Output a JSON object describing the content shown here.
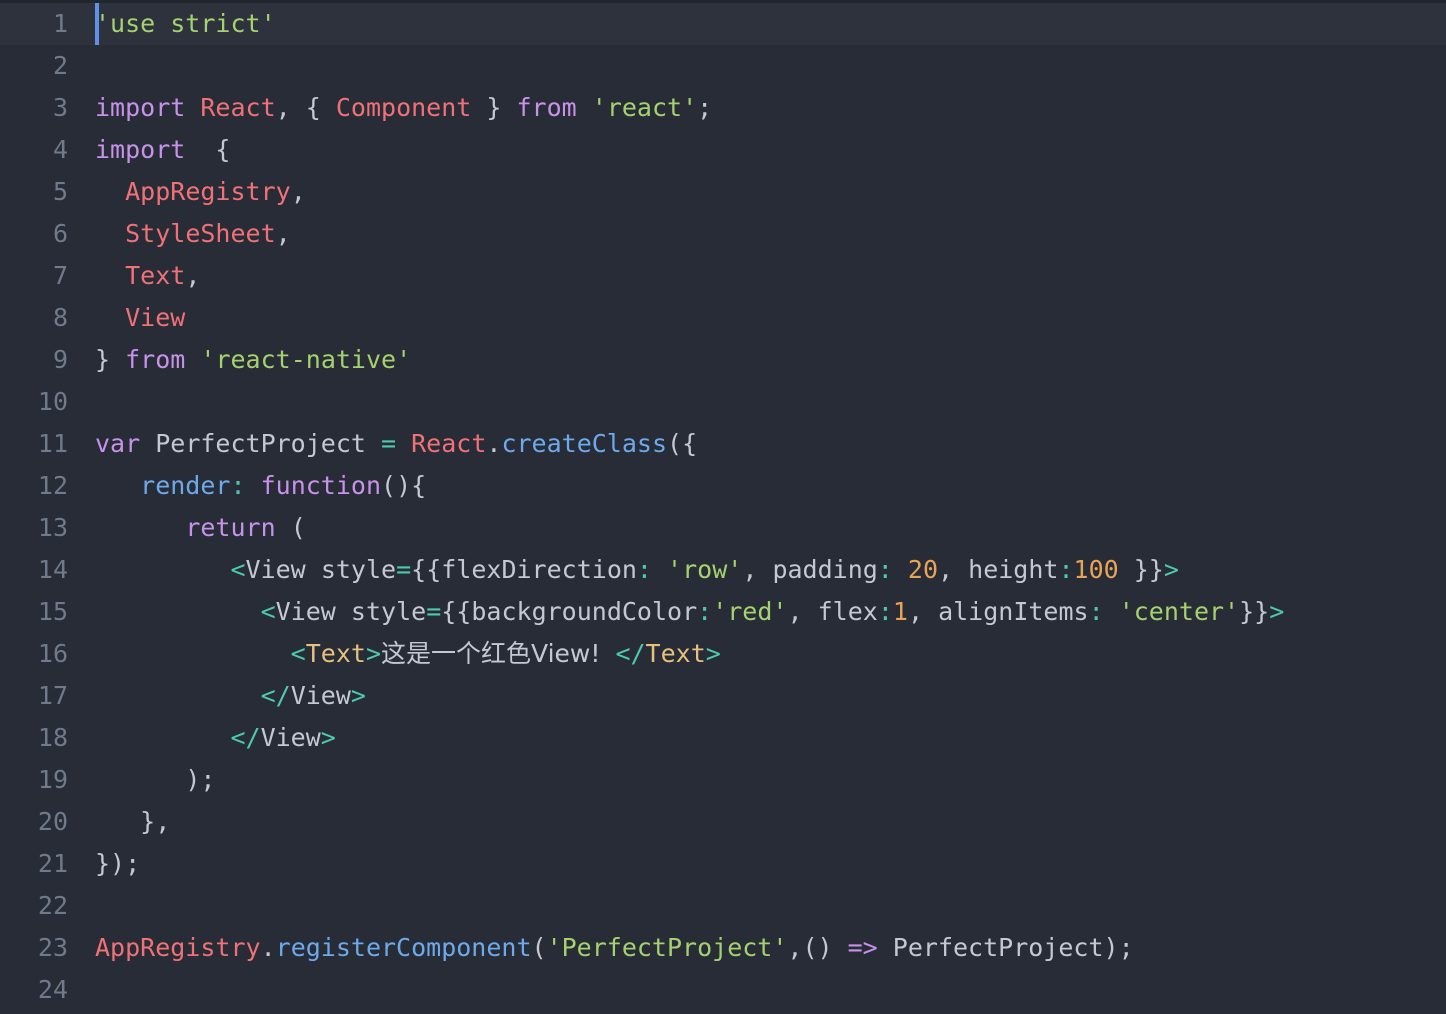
{
  "editor": {
    "name": "code-editor",
    "language": "javascript-jsx",
    "theme": {
      "background": "#272c36",
      "active_line_background": "#2d323d",
      "gutter_text": "#717a8a",
      "caret": "#5c93e8",
      "plain": "#c3c8d2",
      "keyword": "#c792ea",
      "class_name": "#f07178",
      "string": "#a5d26e",
      "function": "#6eaaeb",
      "operator": "#4ec9b0",
      "number": "#e8a355",
      "tag_name": "#e8c07d"
    },
    "caret_line": 1,
    "caret_column": 1,
    "total_lines": 24
  },
  "lines": [
    {
      "num": "1",
      "active": true,
      "tokens": [
        {
          "t": "'use strict'",
          "c": "t-string"
        }
      ]
    },
    {
      "num": "2",
      "active": false,
      "tokens": []
    },
    {
      "num": "3",
      "active": false,
      "tokens": [
        {
          "t": "import",
          "c": "t-keyword"
        },
        {
          "t": " ",
          "c": "t-plain"
        },
        {
          "t": "React",
          "c": "t-class"
        },
        {
          "t": ", ",
          "c": "t-punct"
        },
        {
          "t": "{ ",
          "c": "t-punct"
        },
        {
          "t": "Component",
          "c": "t-class"
        },
        {
          "t": " }",
          "c": "t-punct"
        },
        {
          "t": " ",
          "c": "t-plain"
        },
        {
          "t": "from",
          "c": "t-keyword"
        },
        {
          "t": " ",
          "c": "t-plain"
        },
        {
          "t": "'react'",
          "c": "t-string"
        },
        {
          "t": ";",
          "c": "t-punct"
        }
      ]
    },
    {
      "num": "4",
      "active": false,
      "tokens": [
        {
          "t": "import",
          "c": "t-keyword"
        },
        {
          "t": "  ",
          "c": "t-plain"
        },
        {
          "t": "{",
          "c": "t-punct"
        }
      ]
    },
    {
      "num": "5",
      "active": false,
      "tokens": [
        {
          "t": "  ",
          "c": "t-plain"
        },
        {
          "t": "AppRegistry",
          "c": "t-class"
        },
        {
          "t": ",",
          "c": "t-punct"
        }
      ]
    },
    {
      "num": "6",
      "active": false,
      "tokens": [
        {
          "t": "  ",
          "c": "t-plain"
        },
        {
          "t": "StyleSheet",
          "c": "t-class"
        },
        {
          "t": ",",
          "c": "t-punct"
        }
      ]
    },
    {
      "num": "7",
      "active": false,
      "tokens": [
        {
          "t": "  ",
          "c": "t-plain"
        },
        {
          "t": "Text",
          "c": "t-class"
        },
        {
          "t": ",",
          "c": "t-punct"
        }
      ]
    },
    {
      "num": "8",
      "active": false,
      "tokens": [
        {
          "t": "  ",
          "c": "t-plain"
        },
        {
          "t": "View",
          "c": "t-class"
        }
      ]
    },
    {
      "num": "9",
      "active": false,
      "tokens": [
        {
          "t": "}",
          "c": "t-punct"
        },
        {
          "t": " ",
          "c": "t-plain"
        },
        {
          "t": "from",
          "c": "t-keyword"
        },
        {
          "t": " ",
          "c": "t-plain"
        },
        {
          "t": "'react-native'",
          "c": "t-string"
        }
      ]
    },
    {
      "num": "10",
      "active": false,
      "tokens": []
    },
    {
      "num": "11",
      "active": false,
      "tokens": [
        {
          "t": "var",
          "c": "t-keyword"
        },
        {
          "t": " ",
          "c": "t-plain"
        },
        {
          "t": "PerfectProject",
          "c": "t-plain"
        },
        {
          "t": " ",
          "c": "t-plain"
        },
        {
          "t": "=",
          "c": "t-operator"
        },
        {
          "t": " ",
          "c": "t-plain"
        },
        {
          "t": "React",
          "c": "t-class"
        },
        {
          "t": ".",
          "c": "t-punct"
        },
        {
          "t": "createClass",
          "c": "t-func"
        },
        {
          "t": "({",
          "c": "t-punct"
        }
      ]
    },
    {
      "num": "12",
      "active": false,
      "tokens": [
        {
          "t": "   ",
          "c": "t-plain"
        },
        {
          "t": "render",
          "c": "t-func"
        },
        {
          "t": ":",
          "c": "t-operator"
        },
        {
          "t": " ",
          "c": "t-plain"
        },
        {
          "t": "function",
          "c": "t-keyword"
        },
        {
          "t": "(){",
          "c": "t-punct"
        }
      ]
    },
    {
      "num": "13",
      "active": false,
      "tokens": [
        {
          "t": "      ",
          "c": "t-plain"
        },
        {
          "t": "return",
          "c": "t-keyword"
        },
        {
          "t": " ",
          "c": "t-plain"
        },
        {
          "t": "(",
          "c": "t-punct"
        }
      ]
    },
    {
      "num": "14",
      "active": false,
      "tokens": [
        {
          "t": "         ",
          "c": "t-plain"
        },
        {
          "t": "<",
          "c": "t-operator"
        },
        {
          "t": "View",
          "c": "t-plain"
        },
        {
          "t": " ",
          "c": "t-plain"
        },
        {
          "t": "style",
          "c": "t-plain"
        },
        {
          "t": "=",
          "c": "t-operator"
        },
        {
          "t": "{{",
          "c": "t-punct"
        },
        {
          "t": "flexDirection",
          "c": "t-plain"
        },
        {
          "t": ":",
          "c": "t-operator"
        },
        {
          "t": " ",
          "c": "t-plain"
        },
        {
          "t": "'row'",
          "c": "t-string"
        },
        {
          "t": ",",
          "c": "t-punct"
        },
        {
          "t": " ",
          "c": "t-plain"
        },
        {
          "t": "padding",
          "c": "t-plain"
        },
        {
          "t": ":",
          "c": "t-operator"
        },
        {
          "t": " ",
          "c": "t-plain"
        },
        {
          "t": "20",
          "c": "t-number"
        },
        {
          "t": ",",
          "c": "t-punct"
        },
        {
          "t": " ",
          "c": "t-plain"
        },
        {
          "t": "height",
          "c": "t-plain"
        },
        {
          "t": ":",
          "c": "t-operator"
        },
        {
          "t": "100",
          "c": "t-number"
        },
        {
          "t": " }}",
          "c": "t-punct"
        },
        {
          "t": ">",
          "c": "t-operator"
        }
      ]
    },
    {
      "num": "15",
      "active": false,
      "tokens": [
        {
          "t": "           ",
          "c": "t-plain"
        },
        {
          "t": "<",
          "c": "t-operator"
        },
        {
          "t": "View",
          "c": "t-plain"
        },
        {
          "t": " ",
          "c": "t-plain"
        },
        {
          "t": "style",
          "c": "t-plain"
        },
        {
          "t": "=",
          "c": "t-operator"
        },
        {
          "t": "{{",
          "c": "t-punct"
        },
        {
          "t": "backgroundColor",
          "c": "t-plain"
        },
        {
          "t": ":",
          "c": "t-operator"
        },
        {
          "t": "'red'",
          "c": "t-string"
        },
        {
          "t": ",",
          "c": "t-punct"
        },
        {
          "t": " ",
          "c": "t-plain"
        },
        {
          "t": "flex",
          "c": "t-plain"
        },
        {
          "t": ":",
          "c": "t-operator"
        },
        {
          "t": "1",
          "c": "t-number"
        },
        {
          "t": ",",
          "c": "t-punct"
        },
        {
          "t": " ",
          "c": "t-plain"
        },
        {
          "t": "alignItems",
          "c": "t-plain"
        },
        {
          "t": ":",
          "c": "t-operator"
        },
        {
          "t": " ",
          "c": "t-plain"
        },
        {
          "t": "'center'",
          "c": "t-string"
        },
        {
          "t": "}}",
          "c": "t-punct"
        },
        {
          "t": ">",
          "c": "t-operator"
        }
      ]
    },
    {
      "num": "16",
      "active": false,
      "tokens": [
        {
          "t": "             ",
          "c": "t-plain"
        },
        {
          "t": "<",
          "c": "t-operator"
        },
        {
          "t": "Text",
          "c": "t-tagname"
        },
        {
          "t": ">",
          "c": "t-operator"
        },
        {
          "t": "这是一个红色View!",
          "c": "t-cjk"
        },
        {
          "t": " ",
          "c": "t-plain"
        },
        {
          "t": "</",
          "c": "t-operator"
        },
        {
          "t": "Text",
          "c": "t-tagname"
        },
        {
          "t": ">",
          "c": "t-operator"
        }
      ]
    },
    {
      "num": "17",
      "active": false,
      "tokens": [
        {
          "t": "           ",
          "c": "t-plain"
        },
        {
          "t": "</",
          "c": "t-operator"
        },
        {
          "t": "View",
          "c": "t-plain"
        },
        {
          "t": ">",
          "c": "t-operator"
        }
      ]
    },
    {
      "num": "18",
      "active": false,
      "tokens": [
        {
          "t": "         ",
          "c": "t-plain"
        },
        {
          "t": "</",
          "c": "t-operator"
        },
        {
          "t": "View",
          "c": "t-plain"
        },
        {
          "t": ">",
          "c": "t-operator"
        }
      ]
    },
    {
      "num": "19",
      "active": false,
      "tokens": [
        {
          "t": "      ",
          "c": "t-plain"
        },
        {
          "t": ");",
          "c": "t-punct"
        }
      ]
    },
    {
      "num": "20",
      "active": false,
      "tokens": [
        {
          "t": "   ",
          "c": "t-plain"
        },
        {
          "t": "},",
          "c": "t-punct"
        }
      ]
    },
    {
      "num": "21",
      "active": false,
      "tokens": [
        {
          "t": "});",
          "c": "t-punct"
        }
      ]
    },
    {
      "num": "22",
      "active": false,
      "tokens": []
    },
    {
      "num": "23",
      "active": false,
      "tokens": [
        {
          "t": "AppRegistry",
          "c": "t-class"
        },
        {
          "t": ".",
          "c": "t-punct"
        },
        {
          "t": "registerComponent",
          "c": "t-func"
        },
        {
          "t": "(",
          "c": "t-punct"
        },
        {
          "t": "'PerfectProject'",
          "c": "t-string"
        },
        {
          "t": ",()",
          "c": "t-punct"
        },
        {
          "t": " ",
          "c": "t-plain"
        },
        {
          "t": "=>",
          "c": "t-arrow"
        },
        {
          "t": " ",
          "c": "t-plain"
        },
        {
          "t": "PerfectProject",
          "c": "t-plain"
        },
        {
          "t": ");",
          "c": "t-punct"
        }
      ]
    },
    {
      "num": "24",
      "active": false,
      "tokens": []
    }
  ]
}
